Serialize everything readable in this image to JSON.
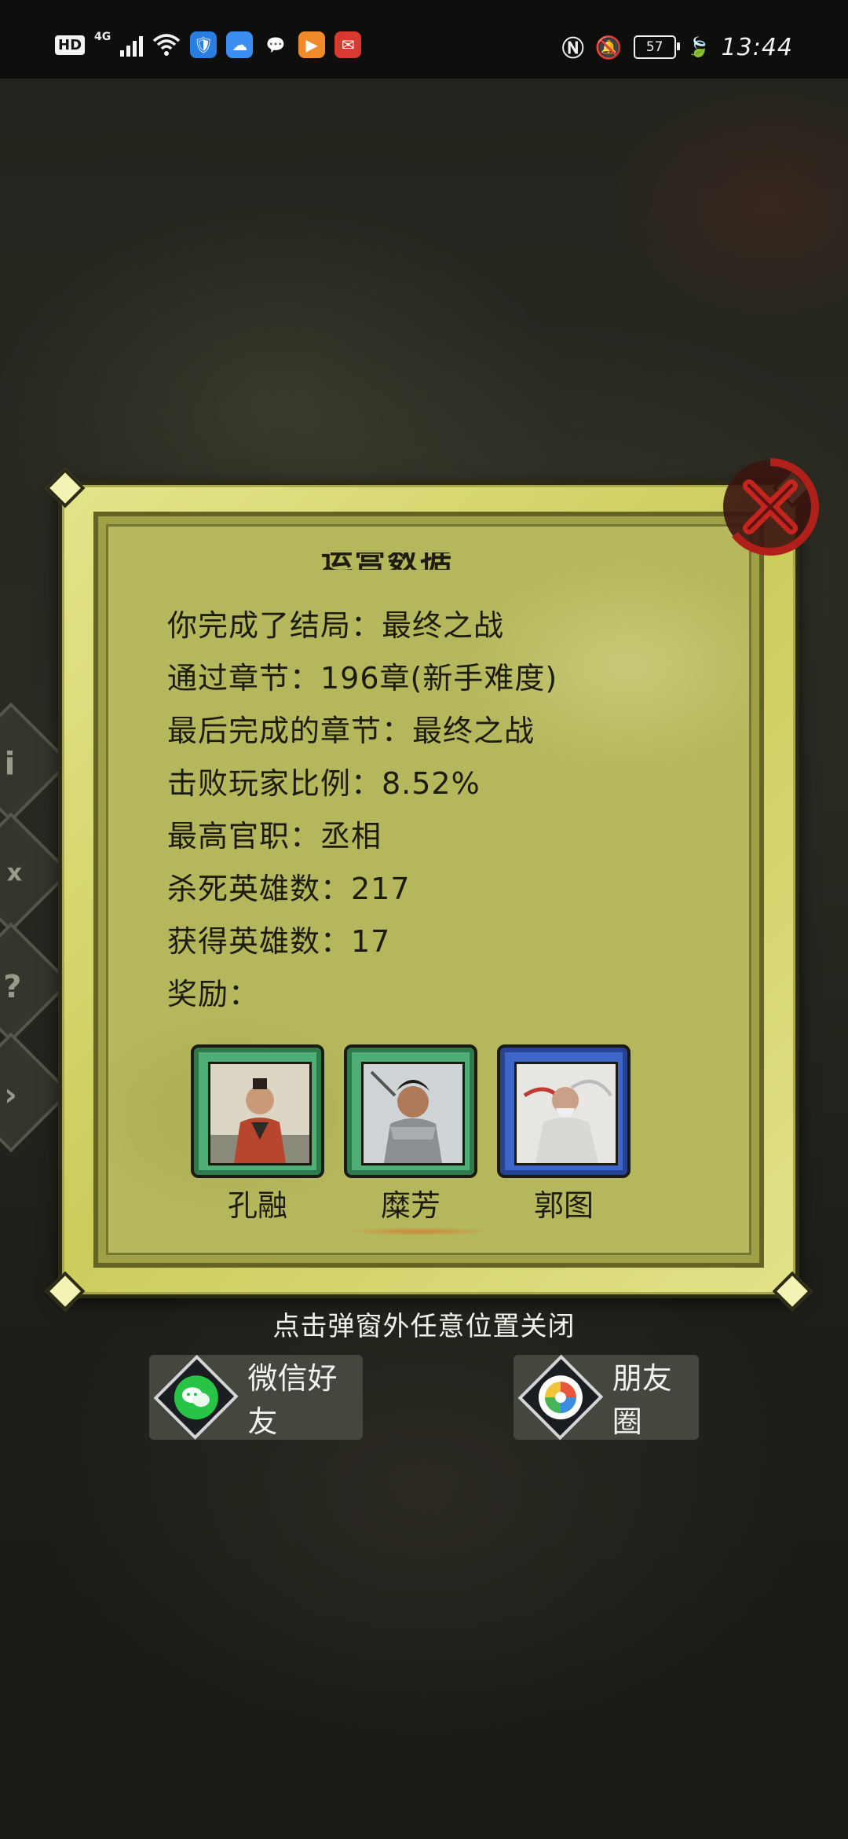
{
  "status_bar": {
    "hd": "HD",
    "network": "4G",
    "time": "13:44",
    "battery": "57"
  },
  "dialog": {
    "title_partial": "运营数据",
    "stats": [
      "你完成了结局：最终之战",
      "通过章节：196章(新手难度)",
      "最后完成的章节：最终之战",
      "击败玩家比例：8.52%",
      "最高官职：丞相",
      "杀死英雄数：217",
      "获得英雄数：17",
      "奖励："
    ],
    "rewards": [
      {
        "name": "孔融",
        "frame": "green"
      },
      {
        "name": "糜芳",
        "frame": "green"
      },
      {
        "name": "郭图",
        "frame": "blue"
      }
    ]
  },
  "hint": "点击弹窗外任意位置关闭",
  "share": {
    "wechat_friends": "微信好友",
    "moments": "朋友圈"
  },
  "colors": {
    "panel": "#b5b75c",
    "frame_green": "#4fae75",
    "frame_blue": "#3e66c9",
    "close_red": "#b0201b"
  }
}
